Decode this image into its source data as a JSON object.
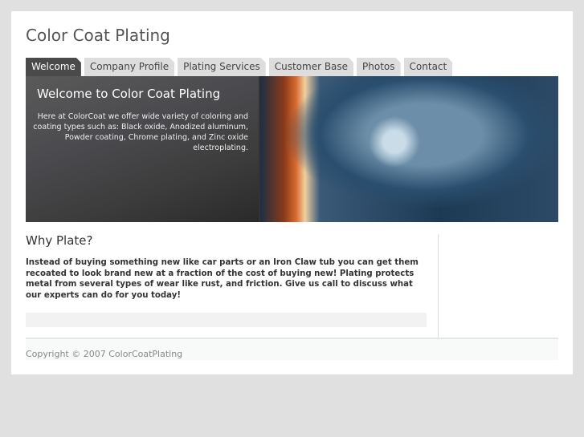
{
  "site": {
    "title": "Color Coat Plating"
  },
  "tabs": [
    {
      "label": "Welcome",
      "active": true
    },
    {
      "label": "Company Profile"
    },
    {
      "label": "Plating Services"
    },
    {
      "label": "Customer Base"
    },
    {
      "label": "Photos"
    },
    {
      "label": "Contact"
    }
  ],
  "banner": {
    "heading": "Welcome to Color Coat Plating",
    "text": "Here at ColorCoat we offer wide variety of coloring and coating types such as: Black oxide, Anodized aluminum, Powder coating, Chrome plating, and Zinc oxide electroplating."
  },
  "content": {
    "heading": "Why Plate?",
    "paragraph": "Instead of buying something new like car parts or an Iron Claw tub you can get them recoated to look brand new at a fraction of the cost of buying new! Plating protects metal from several types of wear like rust, and friction. Give us call to discuss what our experts can do for you today!"
  },
  "footer": {
    "copyright": "Copyright © 2007 ColorCoatPlating"
  }
}
